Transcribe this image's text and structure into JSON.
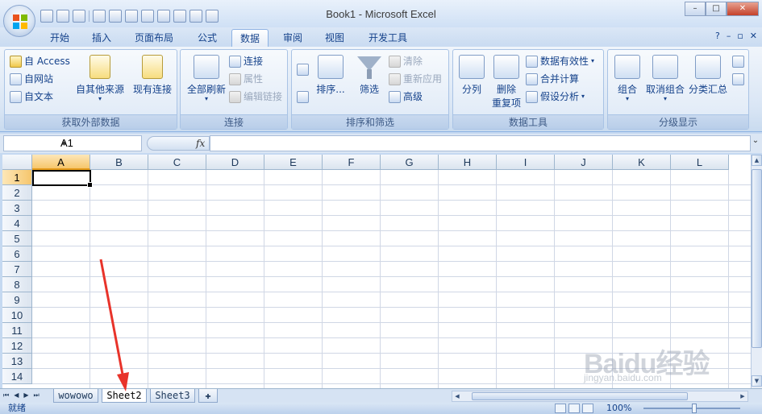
{
  "window": {
    "title": "Book1 - Microsoft Excel",
    "min": "–",
    "max": "□",
    "close": "✕"
  },
  "ribbon_tabs": [
    "开始",
    "插入",
    "页面布局",
    "公式",
    "数据",
    "审阅",
    "视图",
    "开发工具"
  ],
  "active_tab": "数据",
  "ribbon": {
    "external": {
      "label": "获取外部数据",
      "access": "自 Access",
      "web": "自网站",
      "text": "自文本",
      "other": "自其他来源",
      "existing": "现有连接"
    },
    "connections": {
      "label": "连接",
      "refresh_all": "全部刷新",
      "connections": "连接",
      "properties": "属性",
      "edit_links": "编辑链接"
    },
    "sort_filter": {
      "label": "排序和筛选",
      "sort": "排序...",
      "filter": "筛选",
      "clear": "清除",
      "reapply": "重新应用",
      "advanced": "高级"
    },
    "data_tools": {
      "label": "数据工具",
      "text_to_columns": "分列",
      "remove_duplicates_1": "删除",
      "remove_duplicates_2": "重复项",
      "validation": "数据有效性",
      "consolidate": "合并计算",
      "what_if": "假设分析"
    },
    "outline": {
      "label": "分级显示",
      "group": "组合",
      "ungroup": "取消组合",
      "subtotal": "分类汇总"
    }
  },
  "formula_bar": {
    "name_box": "A1",
    "fx": "fx",
    "formula": ""
  },
  "grid": {
    "columns": [
      "A",
      "B",
      "C",
      "D",
      "E",
      "F",
      "G",
      "H",
      "I",
      "J",
      "K",
      "L"
    ],
    "rows": [
      "1",
      "2",
      "3",
      "4",
      "5",
      "6",
      "7",
      "8",
      "9",
      "10",
      "11",
      "12",
      "13",
      "14"
    ],
    "active_cell": "A1"
  },
  "sheets": [
    "wowowo",
    "Sheet2",
    "Sheet3"
  ],
  "active_sheet": "Sheet2",
  "status": {
    "ready": "就绪",
    "zoom": "100%"
  },
  "watermark": {
    "brand": "Baidu经验",
    "url": "jingyan.baidu.com"
  },
  "colors": {
    "annotation_arrow": "#e8332a",
    "selected_header": "#f6c66c"
  },
  "icons": {
    "office_button": "office-logo-icon",
    "undo": "undo-icon",
    "redo": "redo-icon",
    "save": "save-icon",
    "filter": "funnel-icon",
    "help": "help-icon"
  }
}
